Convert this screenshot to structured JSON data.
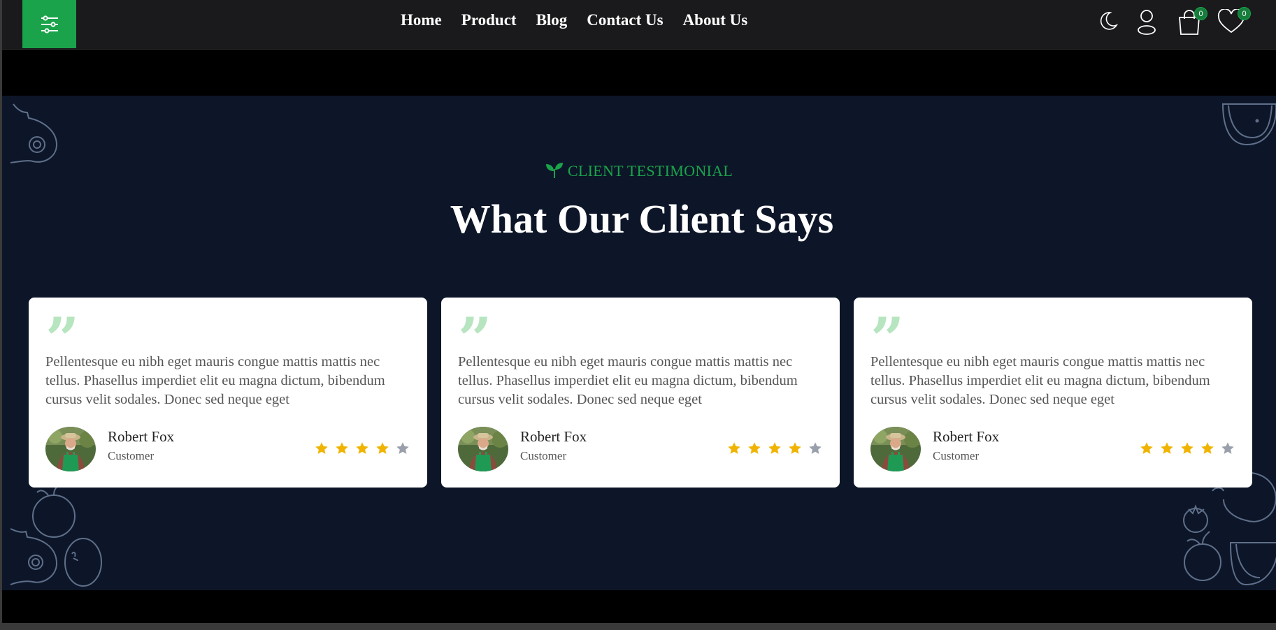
{
  "header": {
    "nav": [
      "Home",
      "Product",
      "Blog",
      "Contact Us",
      "About Us"
    ],
    "cart_count": "0",
    "wishlist_count": "0",
    "icons": [
      "filter-menu-icon",
      "moon-icon",
      "user-icon",
      "shopping-bag-icon",
      "heart-icon"
    ]
  },
  "section": {
    "subtitle": "CLIENT TESTIMONIAL",
    "title": "What Our Client Says"
  },
  "testimonials": [
    {
      "text": "Pellentesque eu nibh eget mauris congue mattis mattis nec tellus. Phasellus imperdiet elit eu magna dictum, bibendum cursus velit sodales. Donec sed neque eget",
      "name": "Robert Fox",
      "role": "Customer",
      "rating": 4,
      "max_rating": 5
    },
    {
      "text": "Pellentesque eu nibh eget mauris congue mattis mattis nec tellus. Phasellus imperdiet elit eu magna dictum, bibendum cursus velit sodales. Donec sed neque eget",
      "name": "Robert Fox",
      "role": "Customer",
      "rating": 4,
      "max_rating": 5
    },
    {
      "text": "Pellentesque eu nibh eget mauris congue mattis mattis nec tellus. Phasellus imperdiet elit eu magna dictum, bibendum cursus velit sodales. Donec sed neque eget",
      "name": "Robert Fox",
      "role": "Customer",
      "rating": 4,
      "max_rating": 5
    }
  ],
  "colors": {
    "accent": "#1aa34a",
    "section_bg": "#0d1628",
    "star_filled": "#f0b400",
    "star_empty": "#9aa0ab"
  }
}
